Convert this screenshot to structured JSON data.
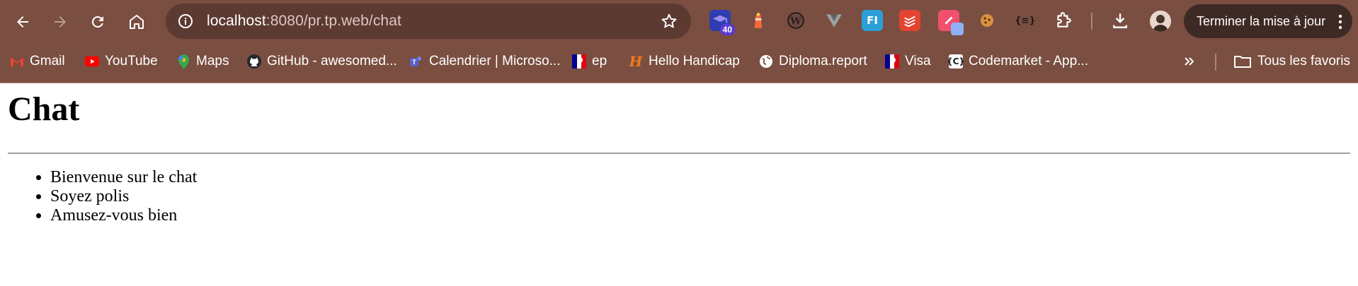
{
  "browser": {
    "nav": {
      "back_icon": "arrow-left-icon",
      "forward_icon": "arrow-right-icon",
      "reload_icon": "reload-icon",
      "home_icon": "home-icon"
    },
    "address_bar": {
      "host": "localhost",
      "path": ":8080/pr.tp.web/chat",
      "site_info_icon": "info-icon",
      "bookmark_icon": "star-icon"
    },
    "extensions": [
      {
        "name": "graduation-cap-extension-icon",
        "badge": "40",
        "color": "#5b3bd1"
      },
      {
        "name": "lighthouse-extension-icon",
        "color": "#f26b3a"
      },
      {
        "name": "wordpress-extension-icon",
        "color": "#3a3a3a"
      },
      {
        "name": "vue-devtools-extension-icon",
        "color": "#5f6b6b"
      },
      {
        "name": "fi-extension-icon",
        "label": "FI",
        "color": "#2a9fd8"
      },
      {
        "name": "todoist-extension-icon",
        "color": "#e44332"
      },
      {
        "name": "link-tool-extension-icon",
        "color": "#f0506e"
      },
      {
        "name": "cookie-extension-icon",
        "color": "#d9903f"
      },
      {
        "name": "json-extension-icon",
        "label": "{≡}",
        "color": "#222222"
      },
      {
        "name": "puzzle-extensions-icon",
        "color": "#ffffff"
      }
    ],
    "download_icon": "download-icon",
    "update_button": {
      "label": "Terminer la mise à jour",
      "menu_icon": "kebab-menu-icon"
    },
    "bookmarks": [
      {
        "label": "Gmail",
        "icon": "gmail-icon",
        "color": "#ea4335"
      },
      {
        "label": "YouTube",
        "icon": "youtube-icon",
        "color": "#ff0000"
      },
      {
        "label": "Maps",
        "icon": "maps-icon",
        "color": "#34a853"
      },
      {
        "label": "GitHub - awesomed...",
        "icon": "github-icon",
        "color": "#24292f"
      },
      {
        "label": "Calendrier | Microso...",
        "icon": "teams-icon",
        "color": "#5b5fc7"
      },
      {
        "label": "ep",
        "icon": "marianne-icon",
        "color": "#000091"
      },
      {
        "label": "Hello Handicap",
        "icon": "hello-handicap-icon",
        "color": "#f07a1a"
      },
      {
        "label": "Diploma.report",
        "icon": "globe-icon",
        "color": "#ffffff"
      },
      {
        "label": "Visa",
        "icon": "marianne-icon",
        "color": "#000091"
      },
      {
        "label": "Codemarket - App...",
        "icon": "codemarket-icon",
        "color": "#ffffff"
      }
    ],
    "more_bookmarks_icon": "double-chevron-icon",
    "all_bookmarks": {
      "label": "Tous les favoris",
      "icon": "folder-icon"
    }
  },
  "page": {
    "title": "Chat",
    "rules": [
      "Bienvenue sur le chat",
      "Soyez polis",
      "Amusez-vous bien"
    ]
  }
}
